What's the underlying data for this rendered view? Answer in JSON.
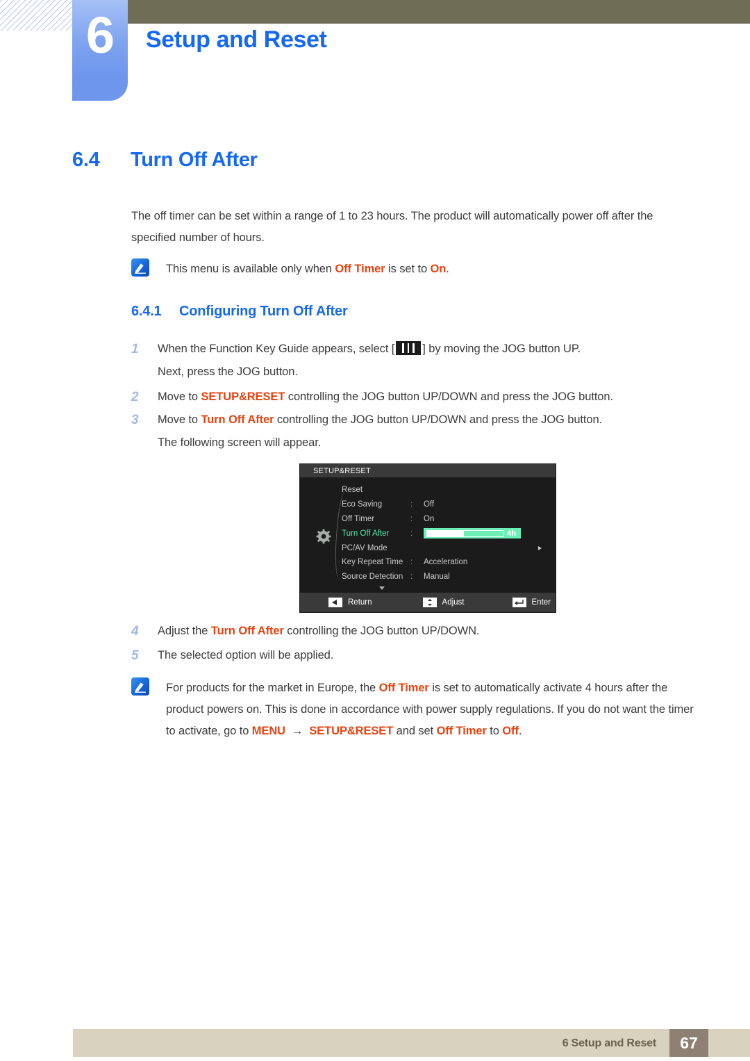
{
  "chapter": {
    "number": "6",
    "title": "Setup and Reset"
  },
  "section": {
    "number": "6.4",
    "title": "Turn Off After"
  },
  "intro": {
    "paragraph": "The off timer can be set within a range of 1 to 23 hours. The product will automatically power off after the specified number of hours."
  },
  "note_top": {
    "icon": "note-pen-icon",
    "text_before": "This menu is available only when ",
    "highlight_1": "Off Timer",
    "text_middle": " is set to ",
    "highlight_2": "On",
    "text_after": "."
  },
  "subsection": {
    "number": "6.4.1",
    "title": "Configuring Turn Off After"
  },
  "steps": [
    {
      "num": "1",
      "line1_before": "When the Function Key Guide appears, select [",
      "line1_icon": "menu-key-icon",
      "line1_after": "] by moving the JOG button UP.",
      "line2": "Next, press the JOG button."
    },
    {
      "num": "2",
      "line1_before": "Move to ",
      "highlight": "SETUP&RESET",
      "line1_after": " controlling the JOG button UP/DOWN and press the JOG button."
    },
    {
      "num": "3",
      "line1_before": "Move to ",
      "highlight": "Turn Off After",
      "line1_after": " controlling the JOG button UP/DOWN and press the JOG button.",
      "line2": "The following screen will appear."
    },
    {
      "num": "4",
      "line1_before": "Adjust the ",
      "highlight": "Turn Off After",
      "line1_after": " controlling the JOG button UP/DOWN."
    },
    {
      "num": "5",
      "line1_before": "The selected option will be applied."
    }
  ],
  "osd": {
    "title": "SETUP&RESET",
    "gear_icon": "gear-icon",
    "rows": [
      {
        "label": "Reset",
        "colon": "",
        "value": "",
        "selected": false,
        "type": "plain"
      },
      {
        "label": "Eco Saving",
        "colon": ":",
        "value": "Off",
        "selected": false,
        "type": "plain"
      },
      {
        "label": "Off Timer",
        "colon": ":",
        "value": "On",
        "selected": false,
        "type": "plain"
      },
      {
        "label": "Turn Off After",
        "colon": ":",
        "value": "4h",
        "selected": true,
        "type": "slider",
        "fill_percent": 48
      },
      {
        "label": "PC/AV Mode",
        "colon": "",
        "value": "",
        "selected": false,
        "type": "submenu"
      },
      {
        "label": "Key Repeat Time",
        "colon": ":",
        "value": "Acceleration",
        "selected": false,
        "type": "plain"
      },
      {
        "label": "Source Detection",
        "colon": ":",
        "value": "Manual",
        "selected": false,
        "type": "plain"
      }
    ],
    "scroll_down_icon": "chevron-down-icon",
    "footer": [
      {
        "icon": "left-arrow-key-icon",
        "label": "Return"
      },
      {
        "icon": "up-down-key-icon",
        "label": "Adjust"
      },
      {
        "icon": "enter-key-icon",
        "label": "Enter"
      }
    ]
  },
  "note_bottom": {
    "icon": "note-pen-icon",
    "seg1": "For products for the market in Europe, the ",
    "hl1": "Off Timer",
    "seg2": " is set to automatically activate 4 hours after the product powers on. This is done in accordance with power supply regulations. If you do not want the timer to activate, go to ",
    "hl2": "MENU",
    "arrow": "→",
    "hl3": "SETUP&RESET",
    "seg3": " and set ",
    "hl4": "Off Timer",
    "seg4": " to ",
    "hl5": "Off",
    "seg5": "."
  },
  "footer": {
    "text": "6 Setup and Reset",
    "page": "67"
  },
  "colors": {
    "accent_blue": "#1569f0",
    "highlight_orange": "#e8420f",
    "olive": "#6f6d56",
    "footer_bar": "#d8d2be",
    "page_badge": "#8e8073",
    "osd_bg": "#1b1b1b",
    "osd_selected": "#4ef0ad",
    "slider_bg": "#6cf0b8"
  }
}
